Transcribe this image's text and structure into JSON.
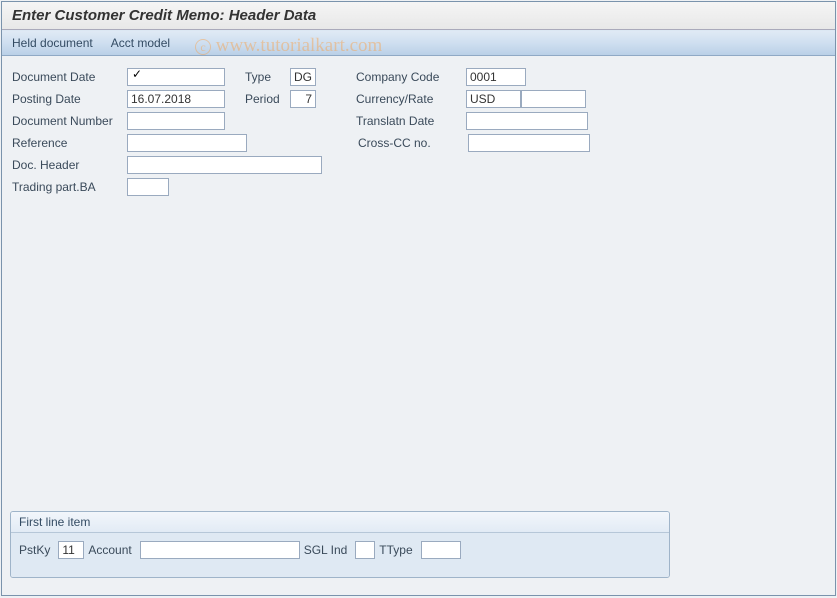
{
  "page_title": "Enter Customer Credit Memo: Header Data",
  "toolbar": {
    "held_document": "Held document",
    "acct_model": "Acct model"
  },
  "watermark": "www.tutorialkart.com",
  "labels": {
    "document_date": "Document Date",
    "posting_date": "Posting Date",
    "document_number": "Document Number",
    "reference": "Reference",
    "doc_header": "Doc. Header",
    "trading_part_ba": "Trading part.BA",
    "type": "Type",
    "period": "Period",
    "company_code": "Company Code",
    "currency_rate": "Currency/Rate",
    "translatn_date": "Translatn Date",
    "cross_cc_no": "Cross-CC no."
  },
  "values": {
    "posting_date": "16.07.2018",
    "type": "DG",
    "period": "7",
    "company_code": "0001",
    "currency": "USD"
  },
  "first_line_item": {
    "title": "First line item",
    "pstky_label": "PstKy",
    "pstky_value": "11",
    "account_label": "Account",
    "sgl_ind_label": "SGL Ind",
    "ttype_label": "TType"
  }
}
